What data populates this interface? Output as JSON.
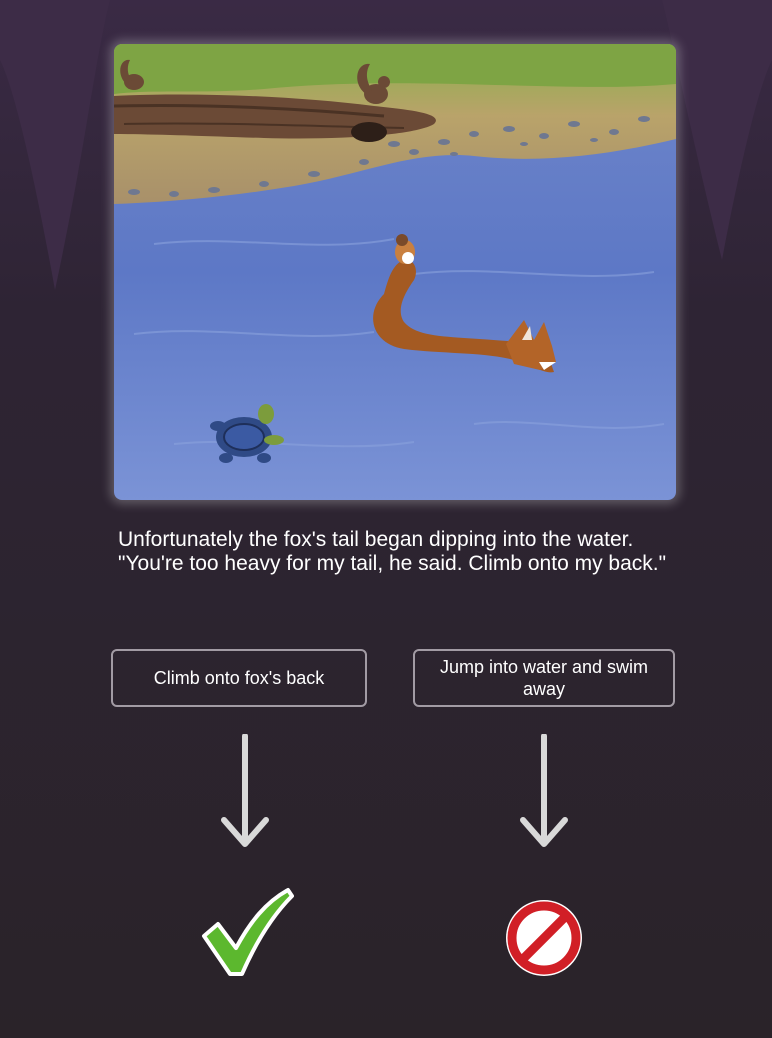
{
  "story": {
    "text": "Unfortunately the fox's tail began dipping into the water. \"You're too heavy for my tail, he said. Climb onto my back.\""
  },
  "choices": [
    {
      "label": "Climb onto fox's back",
      "outcome": "check-icon"
    },
    {
      "label": "Jump into water and swim away",
      "outcome": "prohibited-icon"
    }
  ],
  "colors": {
    "background": "#2e2434",
    "check": "#5cb82e",
    "prohibited": "#d11f26",
    "water": "#5a78c8",
    "button_border": "#a29ba4"
  }
}
